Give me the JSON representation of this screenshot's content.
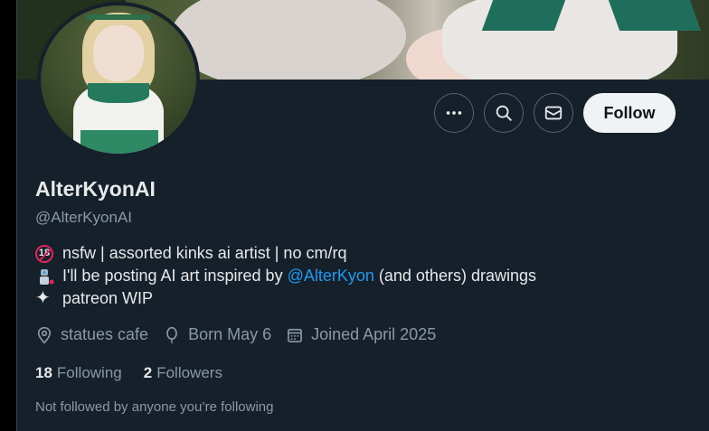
{
  "profile": {
    "display_name": "AlterKyonAI",
    "handle": "@AlterKyonAI",
    "bio": {
      "line1": {
        "icon": "no-under-18-icon",
        "badge": "18",
        "text": "nsfw | assorted kinks ai artist | no cm/rq"
      },
      "line2": {
        "icon": "robot-artist-icon",
        "before": "I'll be posting AI art inspired by",
        "mention": "@AlterKyon",
        "after": "(and others) drawings"
      },
      "line3": {
        "icon": "sparkle-icon",
        "glyph": "✦",
        "text": "patreon WIP"
      }
    },
    "meta": {
      "location": "statues cafe",
      "birthday": "Born May 6",
      "joined": "Joined April 2025"
    },
    "stats": {
      "following_count": "18",
      "following_label": "Following",
      "followers_count": "2",
      "followers_label": "Followers"
    },
    "followed_by_note": "Not followed by anyone you’re following"
  },
  "actions": {
    "more_icon": "more-dots-icon",
    "search_icon": "search-icon",
    "message_icon": "envelope-icon",
    "follow_label": "Follow"
  },
  "colors": {
    "background": "#15202b",
    "text": "#e7e9ea",
    "muted": "#8b98a5",
    "link": "#1d9bf0",
    "follow_bg": "#eff3f4"
  }
}
